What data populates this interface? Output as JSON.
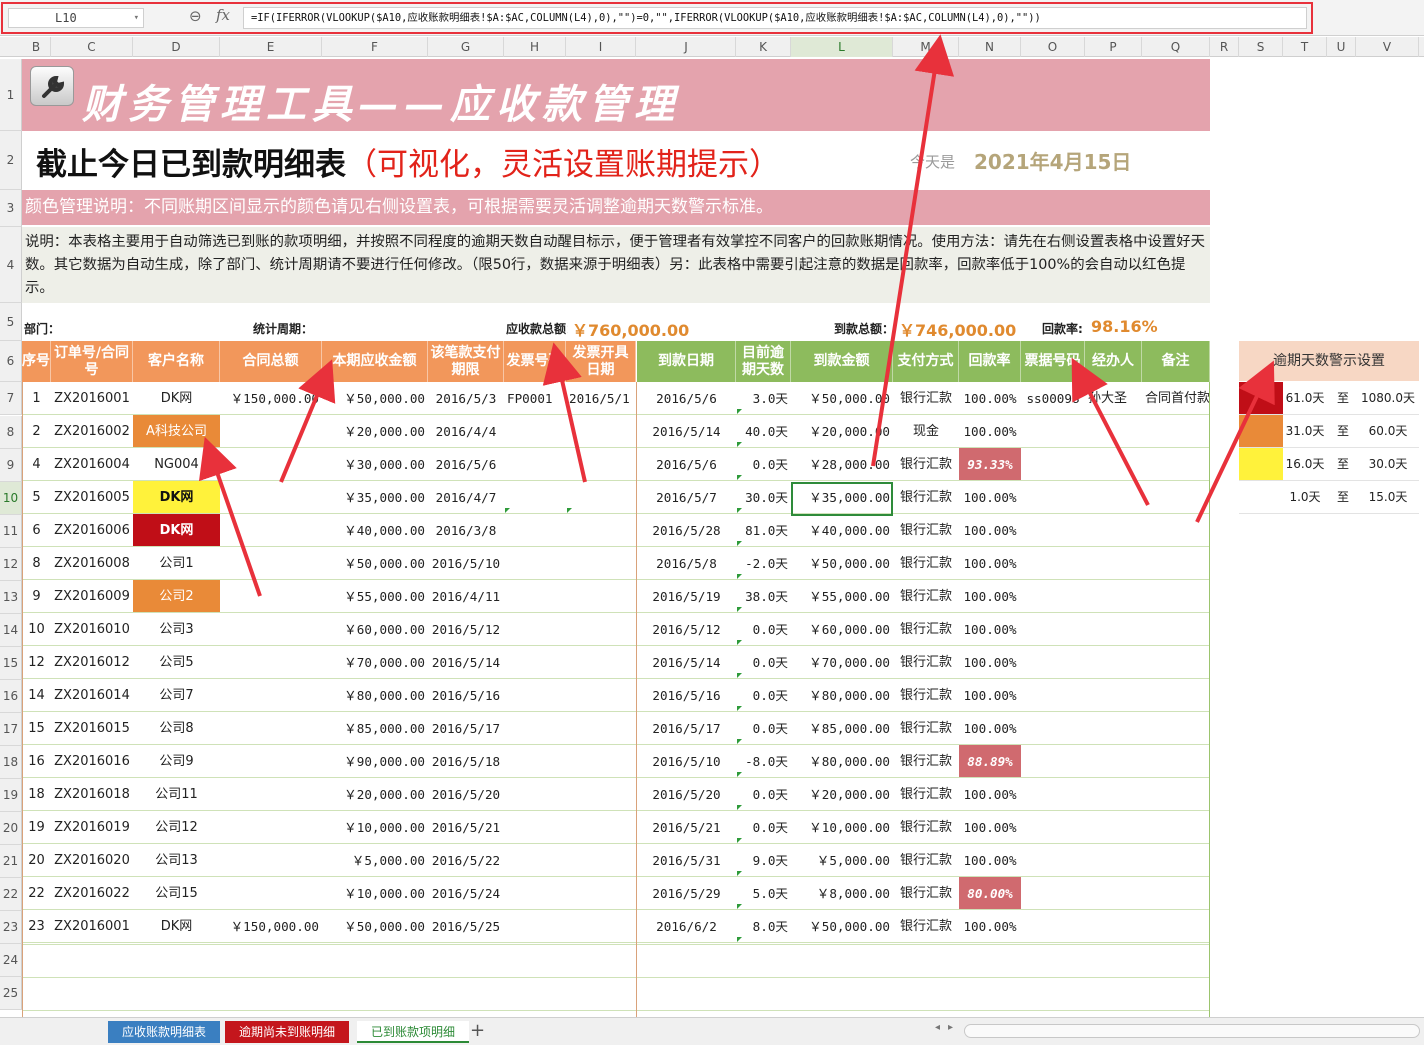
{
  "formula_bar": {
    "name_box": "L10",
    "fx": "fx",
    "formula": "=IF(IFERROR(VLOOKUP($A10,应收账款明细表!$A:$AC,COLUMN(L4),0),\"\")=0,\"\",IFERROR(VLOOKUP($A10,应收账款明细表!$A:$AC,COLUMN(L4),0),\"\"))"
  },
  "columns": [
    "B",
    "C",
    "D",
    "E",
    "F",
    "G",
    "H",
    "I",
    "J",
    "K",
    "L",
    "M",
    "N",
    "O",
    "P",
    "Q",
    "R",
    "S",
    "T",
    "U",
    "V"
  ],
  "rows": [
    "1",
    "2",
    "3",
    "4",
    "5",
    "6",
    "7",
    "8",
    "9",
    "10",
    "11",
    "12",
    "13",
    "14",
    "15",
    "16",
    "17",
    "18",
    "19",
    "20",
    "21",
    "22",
    "23",
    "24",
    "25"
  ],
  "title": "财务管理工具——应收款管理",
  "subtitle": "截止今日已到款明细表",
  "subtitle_note": "（可视化，灵活设置账期提示）",
  "today_label": "今天是",
  "today_value": "2021年4月15日",
  "color_note": "颜色管理说明：不同账期区间显示的颜色请见右侧设置表，可根据需要灵活调整逾期天数警示标准。",
  "description": "说明：本表格主要用于自动筛选已到账的款项明细，并按照不同程度的逾期天数自动醒目标示，便于管理者有效掌控不同客户的回款账期情况。使用方法：请先在右侧设置表格中设置好天数。其它数据为自动生成，除了部门、统计周期请不要进行任何修改。（限50行，数据来源于明细表）另：此表格中需要引起注意的数据是回款率，回款率低于100%的会自动以红色提示。",
  "stats": {
    "dept_label": "部门：",
    "period_label": "统计周期：",
    "receivable_label": "应收款总额：",
    "receivable_value": "￥760,000.00",
    "received_label": "到款总额：",
    "received_value": "￥746,000.00",
    "rate_label": "回款率:",
    "rate_value": "98.16%"
  },
  "headers": {
    "seq": "序号",
    "order": "订单号/合同号",
    "customer": "客户名称",
    "contract": "合同总额",
    "due_amount": "本期应收金额",
    "pay_deadline": "该笔款支付期限",
    "invoice_no": "发票号码",
    "invoice_date": "发票开具日期",
    "arrive_date": "到款日期",
    "overdue_days": "目前逾期天数",
    "arrive_amount": "到款金额",
    "pay_method": "支付方式",
    "rate": "回款率",
    "bill_no": "票据号码",
    "handler": "经办人",
    "remark": "备注"
  },
  "table_rows": [
    {
      "seq": "1",
      "order": "ZX2016001",
      "customer": "DK网",
      "contract": "￥150,000.00",
      "due": "￥50,000.00",
      "deadline": "2016/5/3",
      "invoice_no": "FP0001",
      "invoice_date": "2016/5/1",
      "arrive_date": "2016/5/6",
      "days": "3.0天",
      "amount": "￥50,000.00",
      "method": "银行汇款",
      "rate": "100.00%",
      "bill": "ss00098",
      "handler": "孙大圣",
      "remark": "合同首付款",
      "customer_style": "",
      "rate_style": ""
    },
    {
      "seq": "2",
      "order": "ZX2016002",
      "customer": "A科技公司",
      "contract": "",
      "due": "￥20,000.00",
      "deadline": "2016/4/4",
      "invoice_no": "",
      "invoice_date": "",
      "arrive_date": "2016/5/14",
      "days": "40.0天",
      "amount": "￥20,000.00",
      "method": "现金",
      "rate": "100.00%",
      "bill": "",
      "handler": "",
      "remark": "",
      "customer_style": "or",
      "rate_style": ""
    },
    {
      "seq": "4",
      "order": "ZX2016004",
      "customer": "NG004",
      "contract": "",
      "due": "￥30,000.00",
      "deadline": "2016/5/6",
      "invoice_no": "",
      "invoice_date": "",
      "arrive_date": "2016/5/6",
      "days": "0.0天",
      "amount": "￥28,000.00",
      "method": "银行汇款",
      "rate": "93.33%",
      "bill": "",
      "handler": "",
      "remark": "",
      "customer_style": "",
      "rate_style": "bad"
    },
    {
      "seq": "5",
      "order": "ZX2016005",
      "customer": "DK网",
      "contract": "",
      "due": "￥35,000.00",
      "deadline": "2016/4/7",
      "invoice_no": "",
      "invoice_date": "",
      "arrive_date": "2016/5/7",
      "days": "30.0天",
      "amount": "￥35,000.00",
      "method": "银行汇款",
      "rate": "100.00%",
      "bill": "",
      "handler": "",
      "remark": "",
      "customer_style": "ye",
      "rate_style": ""
    },
    {
      "seq": "6",
      "order": "ZX2016006",
      "customer": "DK网",
      "contract": "",
      "due": "￥40,000.00",
      "deadline": "2016/3/8",
      "invoice_no": "",
      "invoice_date": "",
      "arrive_date": "2016/5/28",
      "days": "81.0天",
      "amount": "￥40,000.00",
      "method": "银行汇款",
      "rate": "100.00%",
      "bill": "",
      "handler": "",
      "remark": "",
      "customer_style": "rd",
      "rate_style": ""
    },
    {
      "seq": "8",
      "order": "ZX2016008",
      "customer": "公司1",
      "contract": "",
      "due": "￥50,000.00",
      "deadline": "2016/5/10",
      "invoice_no": "",
      "invoice_date": "",
      "arrive_date": "2016/5/8",
      "days": "-2.0天",
      "amount": "￥50,000.00",
      "method": "银行汇款",
      "rate": "100.00%",
      "bill": "",
      "handler": "",
      "remark": "",
      "customer_style": "",
      "rate_style": ""
    },
    {
      "seq": "9",
      "order": "ZX2016009",
      "customer": "公司2",
      "contract": "",
      "due": "￥55,000.00",
      "deadline": "2016/4/11",
      "invoice_no": "",
      "invoice_date": "",
      "arrive_date": "2016/5/19",
      "days": "38.0天",
      "amount": "￥55,000.00",
      "method": "银行汇款",
      "rate": "100.00%",
      "bill": "",
      "handler": "",
      "remark": "",
      "customer_style": "or",
      "rate_style": ""
    },
    {
      "seq": "10",
      "order": "ZX2016010",
      "customer": "公司3",
      "contract": "",
      "due": "￥60,000.00",
      "deadline": "2016/5/12",
      "invoice_no": "",
      "invoice_date": "",
      "arrive_date": "2016/5/12",
      "days": "0.0天",
      "amount": "￥60,000.00",
      "method": "银行汇款",
      "rate": "100.00%",
      "bill": "",
      "handler": "",
      "remark": "",
      "customer_style": "",
      "rate_style": ""
    },
    {
      "seq": "12",
      "order": "ZX2016012",
      "customer": "公司5",
      "contract": "",
      "due": "￥70,000.00",
      "deadline": "2016/5/14",
      "invoice_no": "",
      "invoice_date": "",
      "arrive_date": "2016/5/14",
      "days": "0.0天",
      "amount": "￥70,000.00",
      "method": "银行汇款",
      "rate": "100.00%",
      "bill": "",
      "handler": "",
      "remark": "",
      "customer_style": "",
      "rate_style": ""
    },
    {
      "seq": "14",
      "order": "ZX2016014",
      "customer": "公司7",
      "contract": "",
      "due": "￥80,000.00",
      "deadline": "2016/5/16",
      "invoice_no": "",
      "invoice_date": "",
      "arrive_date": "2016/5/16",
      "days": "0.0天",
      "amount": "￥80,000.00",
      "method": "银行汇款",
      "rate": "100.00%",
      "bill": "",
      "handler": "",
      "remark": "",
      "customer_style": "",
      "rate_style": ""
    },
    {
      "seq": "15",
      "order": "ZX2016015",
      "customer": "公司8",
      "contract": "",
      "due": "￥85,000.00",
      "deadline": "2016/5/17",
      "invoice_no": "",
      "invoice_date": "",
      "arrive_date": "2016/5/17",
      "days": "0.0天",
      "amount": "￥85,000.00",
      "method": "银行汇款",
      "rate": "100.00%",
      "bill": "",
      "handler": "",
      "remark": "",
      "customer_style": "",
      "rate_style": ""
    },
    {
      "seq": "16",
      "order": "ZX2016016",
      "customer": "公司9",
      "contract": "",
      "due": "￥90,000.00",
      "deadline": "2016/5/18",
      "invoice_no": "",
      "invoice_date": "",
      "arrive_date": "2016/5/10",
      "days": "-8.0天",
      "amount": "￥80,000.00",
      "method": "银行汇款",
      "rate": "88.89%",
      "bill": "",
      "handler": "",
      "remark": "",
      "customer_style": "",
      "rate_style": "bad"
    },
    {
      "seq": "18",
      "order": "ZX2016018",
      "customer": "公司11",
      "contract": "",
      "due": "￥20,000.00",
      "deadline": "2016/5/20",
      "invoice_no": "",
      "invoice_date": "",
      "arrive_date": "2016/5/20",
      "days": "0.0天",
      "amount": "￥20,000.00",
      "method": "银行汇款",
      "rate": "100.00%",
      "bill": "",
      "handler": "",
      "remark": "",
      "customer_style": "",
      "rate_style": ""
    },
    {
      "seq": "19",
      "order": "ZX2016019",
      "customer": "公司12",
      "contract": "",
      "due": "￥10,000.00",
      "deadline": "2016/5/21",
      "invoice_no": "",
      "invoice_date": "",
      "arrive_date": "2016/5/21",
      "days": "0.0天",
      "amount": "￥10,000.00",
      "method": "银行汇款",
      "rate": "100.00%",
      "bill": "",
      "handler": "",
      "remark": "",
      "customer_style": "",
      "rate_style": ""
    },
    {
      "seq": "20",
      "order": "ZX2016020",
      "customer": "公司13",
      "contract": "",
      "due": "￥5,000.00",
      "deadline": "2016/5/22",
      "invoice_no": "",
      "invoice_date": "",
      "arrive_date": "2016/5/31",
      "days": "9.0天",
      "amount": "￥5,000.00",
      "method": "银行汇款",
      "rate": "100.00%",
      "bill": "",
      "handler": "",
      "remark": "",
      "customer_style": "",
      "rate_style": ""
    },
    {
      "seq": "22",
      "order": "ZX2016022",
      "customer": "公司15",
      "contract": "",
      "due": "￥10,000.00",
      "deadline": "2016/5/24",
      "invoice_no": "",
      "invoice_date": "",
      "arrive_date": "2016/5/29",
      "days": "5.0天",
      "amount": "￥8,000.00",
      "method": "银行汇款",
      "rate": "80.00%",
      "bill": "",
      "handler": "",
      "remark": "",
      "customer_style": "",
      "rate_style": "bad"
    },
    {
      "seq": "23",
      "order": "ZX2016001",
      "customer": "DK网",
      "contract": "￥150,000.00",
      "due": "￥50,000.00",
      "deadline": "2016/5/25",
      "invoice_no": "",
      "invoice_date": "",
      "arrive_date": "2016/6/2",
      "days": "8.0天",
      "amount": "￥50,000.00",
      "method": "银行汇款",
      "rate": "100.00%",
      "bill": "",
      "handler": "",
      "remark": "",
      "customer_style": "",
      "rate_style": ""
    }
  ],
  "warning": {
    "title": "逾期天数警示设置",
    "to": "至",
    "rows": [
      {
        "from": "61.0天",
        "to_val": "1080.0天",
        "color": "#c00e17"
      },
      {
        "from": "31.0天",
        "to_val": "60.0天",
        "color": "#e98a38"
      },
      {
        "from": "16.0天",
        "to_val": "30.0天",
        "color": "#fff23b"
      },
      {
        "from": "1.0天",
        "to_val": "15.0天",
        "color": "#ffffff"
      }
    ]
  },
  "tabs": {
    "tab1": "应收账款明细表",
    "tab2": "逾期尚未到账明细",
    "tab3": "已到账款项明细",
    "add": "+"
  },
  "colors": {
    "accent_pink": "#e4a3ad",
    "header_orange": "#f2975b",
    "header_green": "#8dbb5d",
    "value_orange": "#e08a2f",
    "annotation_red": "#e8313b"
  }
}
